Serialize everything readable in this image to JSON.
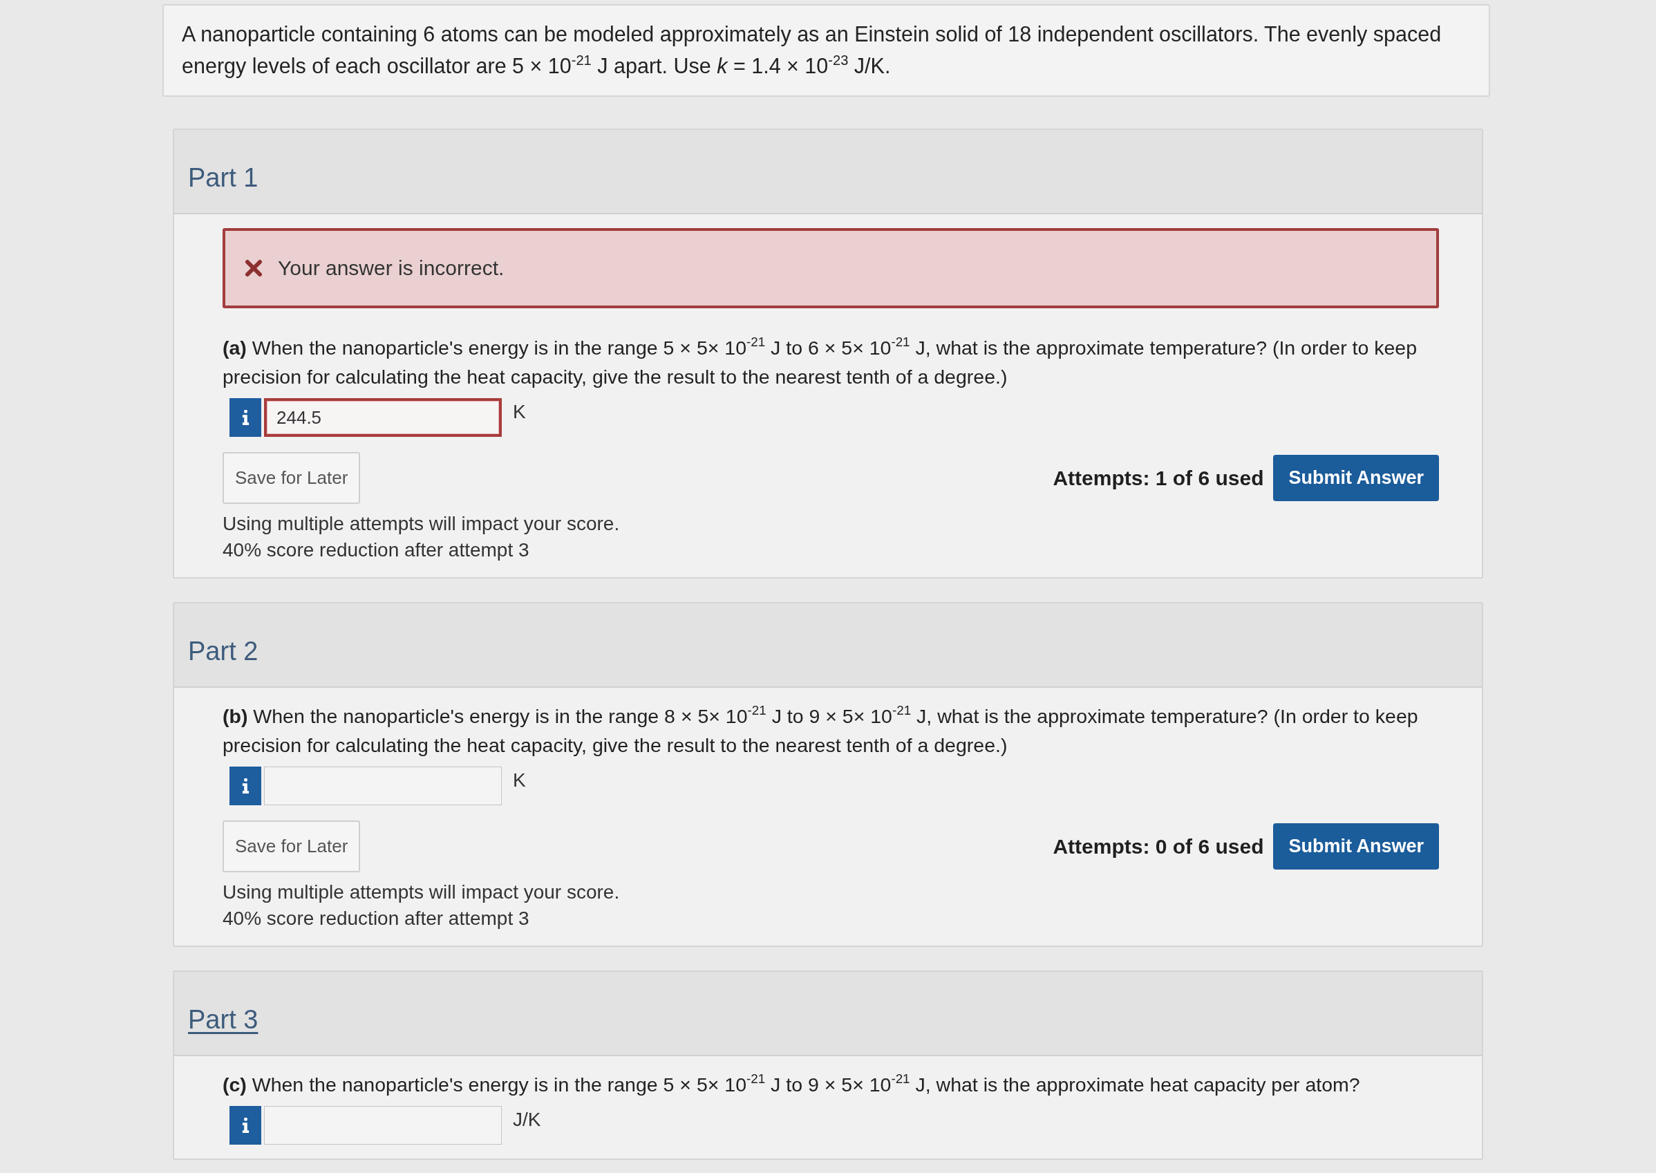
{
  "intro": "A nanoparticle containing 6 atoms can be modeled approximately as an Einstein solid of 18 independent oscillators. The evenly spaced energy levels of each oscillator are 5 × 10$^{-21}$ J apart. Use *k* = 1.4 × 10$^{-23}$ J/K.",
  "parts": [
    {
      "title": "Part 1",
      "title_underlined": false,
      "feedback": {
        "kind": "incorrect",
        "text": "Your answer is incorrect."
      },
      "question": "**(a)** When the nanoparticle's energy is in the range 5 × 5× 10$^{-21}$ J to 6 × 5× 10$^{-21}$ J, what is the approximate temperature? (In order to keep precision for calculating the heat capacity, give the result to the nearest tenth of a degree.)",
      "answer": {
        "value": "244.5",
        "unit": "K",
        "incorrect": true
      },
      "save_button": "Save for Later",
      "attempts": "Attempts: 1 of 6 used",
      "submit_button": "Submit Answer",
      "notes": [
        "Using multiple attempts will impact your score.",
        "40% score reduction after attempt 3"
      ]
    },
    {
      "title": "Part 2",
      "title_underlined": false,
      "question": "**(b)** When the nanoparticle's energy is in the range 8 × 5× 10$^{-21}$ J to 9 × 5× 10$^{-21}$ J, what is the approximate temperature? (In order to keep precision for calculating the heat capacity, give the result to the nearest tenth of a degree.)",
      "answer": {
        "unit": "K",
        "incorrect": false
      },
      "save_button": "Save for Later",
      "attempts": "Attempts: 0 of 6 used",
      "submit_button": "Submit Answer",
      "notes": [
        "Using multiple attempts will impact your score.",
        "40% score reduction after attempt 3"
      ]
    },
    {
      "title": "Part 3",
      "title_underlined": true,
      "question": "**(c)** When the nanoparticle's energy is in the range 5 × 5× 10$^{-21}$ J to 9 × 5× 10$^{-21}$ J, what is the approximate heat capacity per atom?",
      "answer": {
        "unit": "J/K",
        "incorrect": false
      }
    }
  ]
}
